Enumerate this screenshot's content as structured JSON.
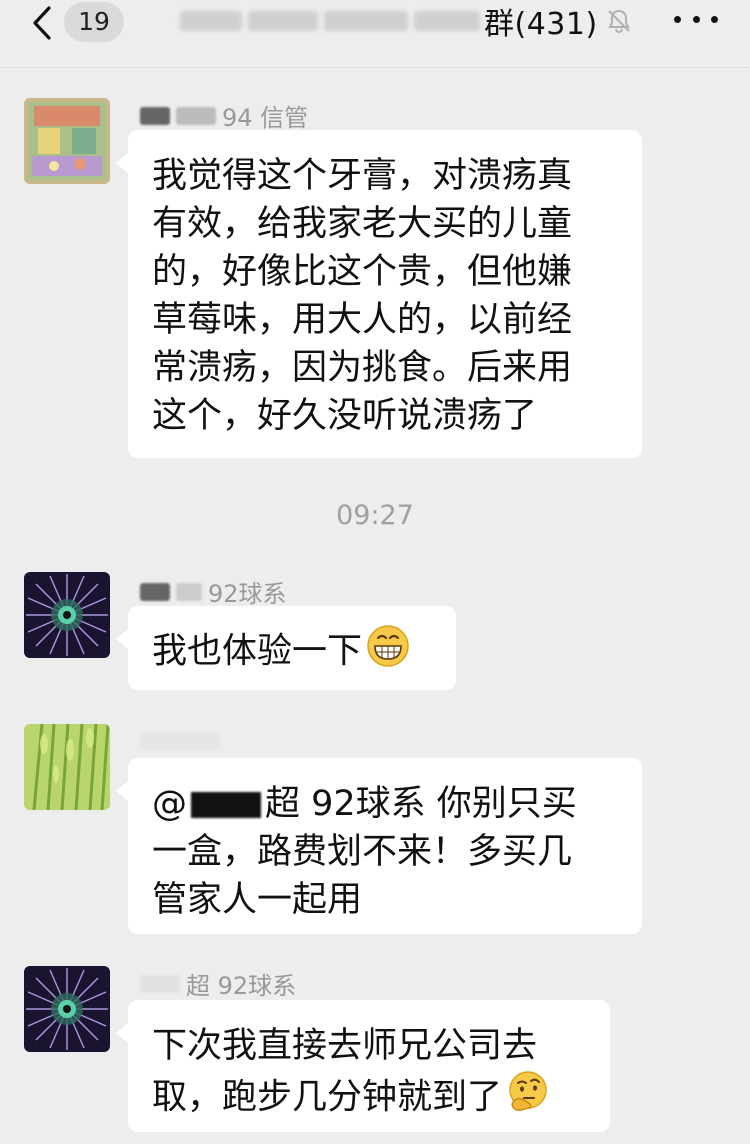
{
  "header": {
    "unread_count": "19",
    "title_suffix": "群(431)"
  },
  "messages": [
    {
      "sender": "94 信管",
      "lines": [
        "我觉得这个牙膏，对溃疡真",
        "有效，给我家老大买的儿童",
        "的，好像比这个贵，但他嫌",
        "草莓味，用大人的，以前经",
        "常溃疡，因为挑食。后来用",
        "这个，好久没听说溃疡了"
      ]
    },
    {
      "sender": "92球系",
      "lines": [
        "我也体验一下"
      ],
      "emoji": "grin-emoji"
    },
    {
      "sender": "",
      "lines_parts": {
        "line1_a": "@",
        "line1_b": "超 92球系 你别只买",
        "line2": "一盒，路费划不来！多买几",
        "line3": "管家人一起用"
      }
    },
    {
      "sender": "超 92球系",
      "lines": [
        "下次我直接去师兄公司去",
        "取，跑步几分钟就到了"
      ],
      "emoji": "thinking-emoji"
    }
  ],
  "timestamp": "09:27",
  "icons": {
    "back": "chevron-left-icon",
    "mute": "bell-slash-icon",
    "more": "more-dots-icon"
  }
}
